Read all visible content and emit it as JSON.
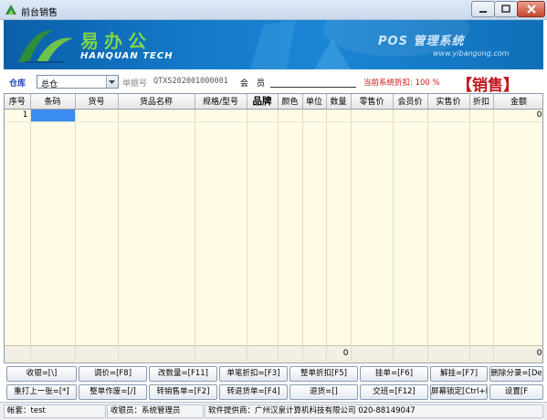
{
  "window": {
    "title": "前台销售"
  },
  "banner": {
    "logo_cn": "易办公",
    "logo_en": "HANQUAN TECH",
    "pos_title": "POS 管理系统",
    "url": "www.yibangong.com"
  },
  "info": {
    "store_label": "仓库",
    "store_value": "总仓",
    "doc_label": "单据号",
    "doc_no": "QTXS202001000001",
    "member_label": "会　员",
    "discount_text": "当前系统折扣: 100 %",
    "mode_text": "【销售】"
  },
  "grid": {
    "headers": [
      "序号",
      "条码",
      "货号",
      "货品名称",
      "规格/型号",
      "品牌",
      "颜色",
      "单位",
      "数量",
      "零售价",
      "会员价",
      "实售价",
      "折扣",
      "金额"
    ],
    "row1": {
      "index": "1",
      "amount": "0"
    },
    "totals": {
      "qty": "0",
      "amount": "0"
    }
  },
  "buttons": {
    "row1": [
      "收银=[\\]",
      "调价=[F8]",
      "改数量=[F11]",
      "单笔折扣=[F3]",
      "整单折扣[F5]",
      "挂单=[F6]",
      "解挂=[F7]",
      "删除分录=[De"
    ],
    "row2": [
      "重打上一张=[*]",
      "整单作废=[/]",
      "转销售单=[F2]",
      "转退货单=[F4]",
      "退货=[]",
      "交班=[F12]",
      "屏幕锁定[Ctrl+P]",
      "设置[F"
    ]
  },
  "status": {
    "account": "帐套：test",
    "cashier": "收银员：系统管理员",
    "provider": "软件提供商：广州汉泉计算机科技有限公司 020-88149047"
  }
}
